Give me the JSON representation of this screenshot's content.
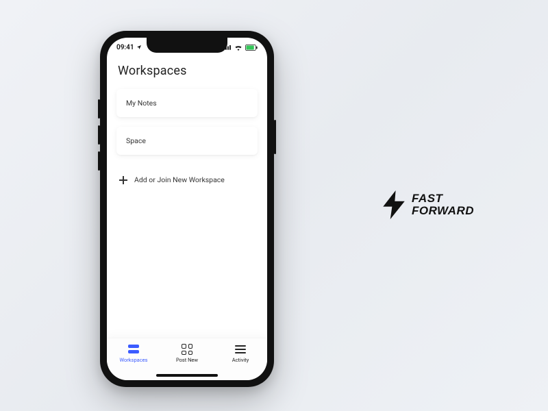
{
  "status_bar": {
    "time": "09:41",
    "signal_icon": "cellular-signal-icon",
    "wifi_icon": "wifi-icon",
    "battery_icon": "battery-icon",
    "location_icon": "location-arrow-icon"
  },
  "page": {
    "title": "Workspaces"
  },
  "workspaces": [
    {
      "name": "My Notes"
    },
    {
      "name": "Space"
    }
  ],
  "add_workspace": {
    "label": "Add or Join New Workspace"
  },
  "tabbar": {
    "items": [
      {
        "label": "Workspaces",
        "icon": "workspaces-icon",
        "active": true
      },
      {
        "label": "Post New",
        "icon": "grid-icon",
        "active": false
      },
      {
        "label": "Activity",
        "icon": "hamburger-icon",
        "active": false
      }
    ]
  },
  "brand": {
    "line1": "FAST",
    "line2": "FORWARD",
    "icon": "lightning-bolt-icon"
  },
  "colors": {
    "accent": "#3b5bff",
    "text": "#222222"
  }
}
